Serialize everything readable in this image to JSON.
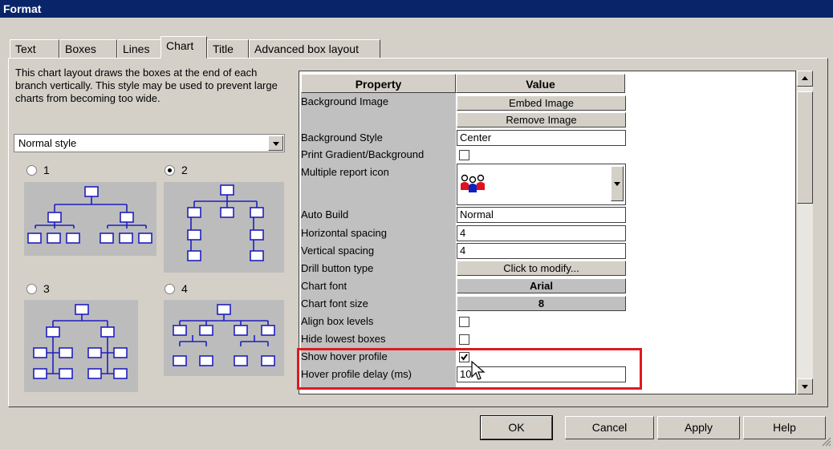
{
  "window": {
    "title": "Format"
  },
  "tabs": [
    "Text",
    "Boxes",
    "Lines",
    "Chart",
    "Title",
    "Advanced box layout"
  ],
  "active_tab": "Chart",
  "description": "This chart layout draws the boxes at the end of each branch vertically. This style may be used to prevent large charts from becoming too wide.",
  "style_select": {
    "value": "Normal style"
  },
  "layout_options": [
    {
      "label": "1",
      "selected": false
    },
    {
      "label": "2",
      "selected": true
    },
    {
      "label": "3",
      "selected": false
    },
    {
      "label": "4",
      "selected": false
    }
  ],
  "grid": {
    "headers": {
      "property": "Property",
      "value": "Value"
    },
    "rows": {
      "background_image": {
        "label": "Background Image",
        "embed": "Embed Image",
        "remove": "Remove Image"
      },
      "background_style": {
        "label": "Background Style",
        "value": "Center"
      },
      "print_gradient": {
        "label": "Print Gradient/Background",
        "checked": false
      },
      "multiple_report_icon": {
        "label": "Multiple report icon",
        "icon": "people-group-icon"
      },
      "auto_build": {
        "label": "Auto Build",
        "value": "Normal"
      },
      "horizontal_spacing": {
        "label": "Horizontal spacing",
        "value": "4"
      },
      "vertical_spacing": {
        "label": "Vertical spacing",
        "value": "4"
      },
      "drill_button_type": {
        "label": "Drill button type",
        "value": "Click to modify..."
      },
      "chart_font": {
        "label": "Chart font",
        "value": "Arial"
      },
      "chart_font_size": {
        "label": "Chart font size",
        "value": "8"
      },
      "align_box_levels": {
        "label": "Align box levels",
        "checked": false
      },
      "hide_lowest_boxes": {
        "label": "Hide lowest boxes",
        "checked": false
      },
      "show_hover_profile": {
        "label": "Show hover profile",
        "checked": true
      },
      "hover_profile_delay": {
        "label": "Hover profile delay (ms)",
        "value": "10"
      }
    }
  },
  "buttons": {
    "ok": "OK",
    "cancel": "Cancel",
    "apply": "Apply",
    "help": "Help"
  },
  "colors": {
    "title_bar": "#0a246a",
    "dialog": "#d4d0c8",
    "highlight_box": "#e0191e",
    "chart_box": "#3030d0"
  }
}
